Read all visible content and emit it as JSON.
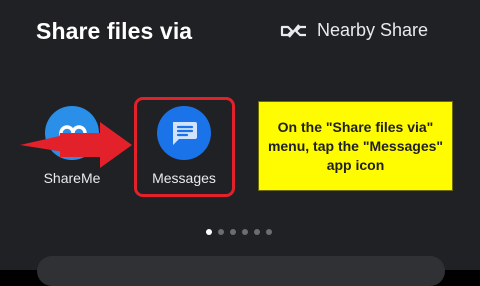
{
  "header": {
    "title": "Share files via",
    "nearby_share_label": "Nearby Share",
    "nearby_share_icon": "nearby-share-icon"
  },
  "apps": [
    {
      "label": "ShareMe",
      "icon": "shareme-icon",
      "color": "#2a8fe8"
    },
    {
      "label": "Messages",
      "icon": "messages-icon",
      "color": "#1a73e8"
    }
  ],
  "callout": {
    "text": "On the \"Share files via\" menu, tap the \"Messages\" app icon"
  },
  "pagination": {
    "pages": 6,
    "current": 1
  },
  "colors": {
    "background": "#202124",
    "highlight": "#e2212a",
    "callout_bg": "#fffb00"
  }
}
